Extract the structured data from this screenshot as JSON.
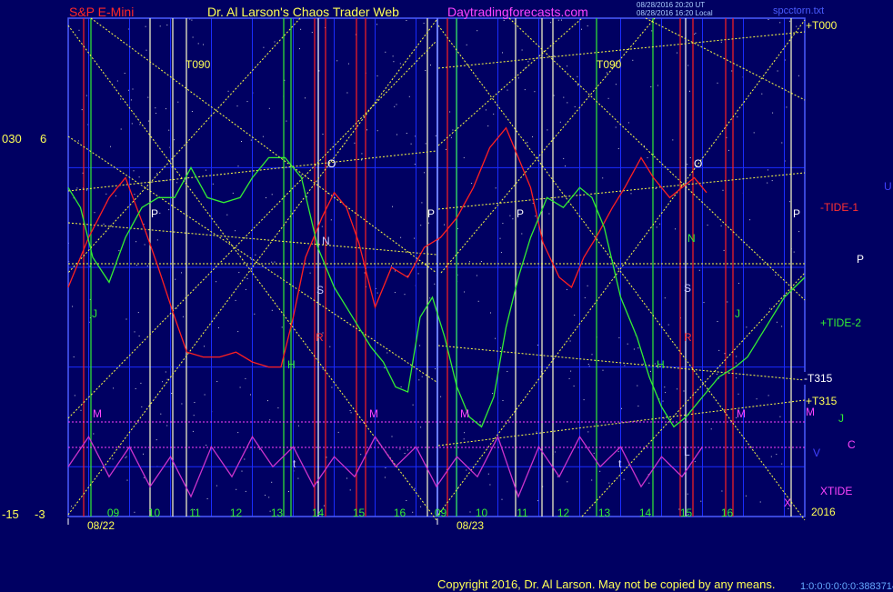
{
  "header": {
    "instrument": "S&P E-Mini",
    "site": "Dr. Al Larson's Chaos Trader Web",
    "url": "Daytradingforecasts.com",
    "generated_line1": "08/28/2016 20:20 UT",
    "generated_line2": "08/28/2016 16:20 Local",
    "file": "spcctorn.txt"
  },
  "footer": {
    "copyright": "Copyright 2016, Dr. Al Larson. May not be copied by any means.",
    "counter": "1:0:0:0:0:0:0:3883714"
  },
  "left_scale": {
    "top_a": "030",
    "top_b": "6",
    "bottom_a": "-15",
    "bottom_b": "-3"
  },
  "dates": {
    "day1": "08/22",
    "day2": "08/23"
  },
  "year": "2016",
  "right_labels": {
    "t000": "+T000",
    "tide1": "-TIDE-1",
    "u": "U",
    "p": "P",
    "tide2": "+TIDE-2",
    "t315n": "-T315",
    "t315p": "+T315",
    "m": "M",
    "j": "J",
    "c": "C",
    "v": "V",
    "xtide": "XTIDE"
  },
  "inner_labels": {
    "t090": "T090",
    "o": "O",
    "n": "N",
    "s": "S",
    "p": "P",
    "h": "H",
    "j": "J",
    "r": "R",
    "m": "M",
    "t": "t",
    "l": "L",
    "x": "X"
  },
  "colors": {
    "background": "#000062",
    "grid": "#1a2cff",
    "frame": "#4a5cff",
    "tide1": "#ff2020",
    "tide2": "#33ee33",
    "xtide": "#cc33cc",
    "t_lines": "#ffff44",
    "m_line": "#ff40ff"
  },
  "chart_data": {
    "type": "line",
    "x_hour_ticks": [
      "09",
      "10",
      "11",
      "12",
      "13",
      "14",
      "15",
      "16",
      "09",
      "10",
      "11",
      "12",
      "13",
      "14",
      "15",
      "16"
    ],
    "series": [
      {
        "name": "-TIDE-1",
        "x": [
          8.5,
          9.0,
          9.5,
          9.9,
          10.4,
          10.7,
          11.1,
          11.4,
          11.8,
          12.2,
          12.6,
          13.0,
          13.4,
          13.7,
          14.0,
          14.3,
          14.7,
          15.0,
          15.3,
          15.6,
          16.0,
          16.4,
          16.8,
          17.2,
          17.6,
          18.0,
          18.4,
          18.8,
          19.2,
          19.5,
          19.8,
          20.1,
          20.5,
          20.8,
          21.1,
          21.4,
          21.8,
          22.1,
          22.5,
          22.8,
          23.2,
          23.5,
          23.8,
          24.1
        ],
        "y": [
          -14,
          -4,
          4,
          8,
          -3,
          -10,
          -20,
          -27,
          -28,
          -28,
          -27,
          -29,
          -30,
          -30,
          -20,
          -8,
          0,
          5,
          2,
          -5,
          -18,
          -10,
          -12,
          -6,
          -4,
          0,
          6,
          14,
          18,
          12,
          6,
          -5,
          -12,
          -14,
          -8,
          -4,
          2,
          6,
          12,
          8,
          4,
          6,
          8,
          5
        ]
      },
      {
        "name": "+TIDE-2",
        "x": [
          8.5,
          8.8,
          9.1,
          9.5,
          9.9,
          10.3,
          10.7,
          11.1,
          11.5,
          11.9,
          12.3,
          12.7,
          13.0,
          13.4,
          13.8,
          14.2,
          14.6,
          15.0,
          15.3,
          15.6,
          15.9,
          16.2,
          16.5,
          16.8,
          17.1,
          17.4,
          17.7,
          18.0,
          18.3,
          18.6,
          18.9,
          19.2,
          19.5,
          19.8,
          20.2,
          20.6,
          21.0,
          21.3,
          21.6,
          22.0,
          22.4,
          22.7,
          23.0,
          23.3,
          23.6,
          24.0,
          24.4,
          24.8,
          25.1,
          25.4,
          25.7,
          26.0,
          26.5
        ],
        "y": [
          6,
          2,
          -8,
          -13,
          -4,
          2,
          4,
          4,
          10,
          4,
          3,
          4,
          8,
          12,
          12,
          8,
          -6,
          -14,
          -18,
          -22,
          -26,
          -29,
          -34,
          -35,
          -20,
          -16,
          -24,
          -34,
          -40,
          -42,
          -36,
          -22,
          -12,
          -4,
          4,
          2,
          6,
          4,
          -2,
          -16,
          -24,
          -32,
          -38,
          -42,
          -40,
          -36,
          -32,
          -30,
          -28,
          -24,
          -20,
          -16,
          -12
        ]
      },
      {
        "name": "XTIDE",
        "x": [
          8.5,
          9.0,
          9.5,
          10.0,
          10.5,
          11.0,
          11.5,
          12.0,
          12.5,
          13.0,
          13.5,
          14.0,
          14.5,
          15.0,
          15.5,
          16.0,
          16.5,
          17.0,
          17.5,
          18.0,
          18.5,
          19.0,
          19.5,
          20.0,
          20.5,
          21.0,
          21.5,
          22.0,
          22.5,
          23.0,
          23.5,
          24.0
        ],
        "y": [
          -50,
          -44,
          -52,
          -46,
          -54,
          -48,
          -56,
          -46,
          -52,
          -44,
          -50,
          -46,
          -54,
          -48,
          -52,
          -44,
          -50,
          -46,
          -54,
          -48,
          -52,
          -44,
          -56,
          -46,
          -52,
          -44,
          -50,
          -46,
          -54,
          -48,
          -52,
          -46
        ]
      }
    ]
  }
}
